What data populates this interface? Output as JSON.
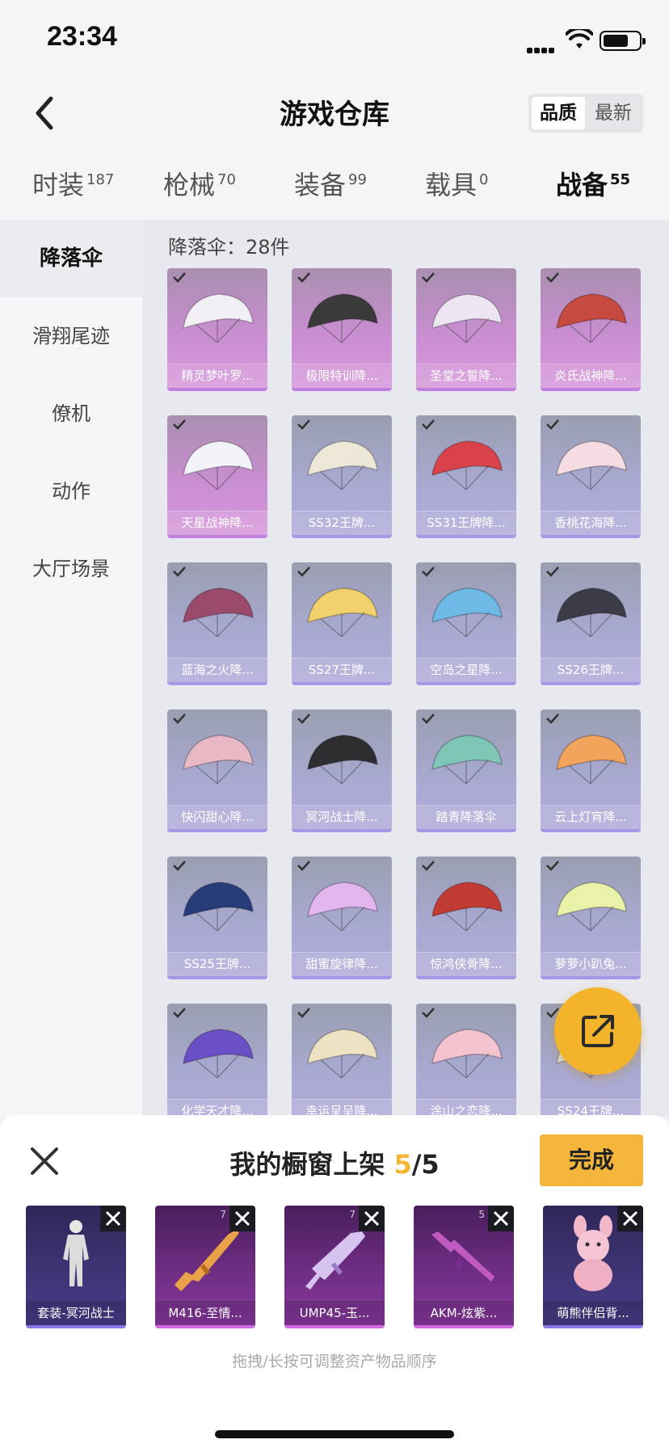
{
  "status": {
    "time": "23:34"
  },
  "header": {
    "title": "游戏仓库",
    "sort_options": [
      "品质",
      "最新"
    ],
    "sort_selected": "品质"
  },
  "tabs": [
    {
      "label": "时装",
      "count": "187"
    },
    {
      "label": "枪械",
      "count": "70"
    },
    {
      "label": "装备",
      "count": "99"
    },
    {
      "label": "载具",
      "count": "0"
    },
    {
      "label": "战备",
      "count": "55",
      "active": true
    }
  ],
  "sidebar": {
    "items": [
      "降落伞",
      "滑翔尾迹",
      "僚机",
      "动作",
      "大厅场景"
    ],
    "active": "降落伞"
  },
  "main": {
    "count_label": "降落伞：28件",
    "items": [
      {
        "name": "精灵梦叶罗...",
        "rarity": "legendary"
      },
      {
        "name": "极限特训降...",
        "rarity": "legendary"
      },
      {
        "name": "圣堂之誓降...",
        "rarity": "legendary"
      },
      {
        "name": "炎氏战神降...",
        "rarity": "legendary"
      },
      {
        "name": "天星战神降...",
        "rarity": "legendary"
      },
      {
        "name": "SS32王牌...",
        "rarity": "epic"
      },
      {
        "name": "SS31王牌降...",
        "rarity": "epic"
      },
      {
        "name": "香桃花海降...",
        "rarity": "epic"
      },
      {
        "name": "蓝海之火降...",
        "rarity": "epic"
      },
      {
        "name": "SS27王牌...",
        "rarity": "epic"
      },
      {
        "name": "空岛之星降...",
        "rarity": "epic"
      },
      {
        "name": "SS26王牌...",
        "rarity": "epic"
      },
      {
        "name": "快闪甜心降...",
        "rarity": "epic"
      },
      {
        "name": "冥河战士降...",
        "rarity": "epic"
      },
      {
        "name": "踏青降落伞",
        "rarity": "epic"
      },
      {
        "name": "云上灯宵降...",
        "rarity": "epic"
      },
      {
        "name": "SS25王牌...",
        "rarity": "epic"
      },
      {
        "name": "甜蜜旋律降...",
        "rarity": "epic"
      },
      {
        "name": "惊鸿侠骨降...",
        "rarity": "epic"
      },
      {
        "name": "萝萝小趴兔...",
        "rarity": "epic"
      },
      {
        "name": "化学天才降...",
        "rarity": "epic"
      },
      {
        "name": "幸运呈呈降...",
        "rarity": "epic"
      },
      {
        "name": "涂山之恋降...",
        "rarity": "epic"
      },
      {
        "name": "SS24王牌...",
        "rarity": "epic"
      }
    ]
  },
  "shelf": {
    "title_prefix": "我的橱窗上架",
    "current": "5",
    "separator": "/",
    "max": "5",
    "done_label": "完成",
    "items": [
      {
        "name": "套装-冥河战士",
        "level": ""
      },
      {
        "name": "M416-至情...",
        "level": "7"
      },
      {
        "name": "UMP45-玉...",
        "level": "7"
      },
      {
        "name": "AKM-炫紫...",
        "level": "5"
      },
      {
        "name": "萌熊伴侣背...",
        "level": ""
      }
    ],
    "hint": "拖拽/长按可调整资产物品顺序"
  },
  "colors": {
    "accent": "#f4b731",
    "legendary": "#cb8ed3",
    "epic": "#a9a9d2"
  },
  "icons": {
    "back": "chevron-left-icon",
    "share": "share-external-icon",
    "close": "close-icon",
    "check": "check-icon"
  }
}
